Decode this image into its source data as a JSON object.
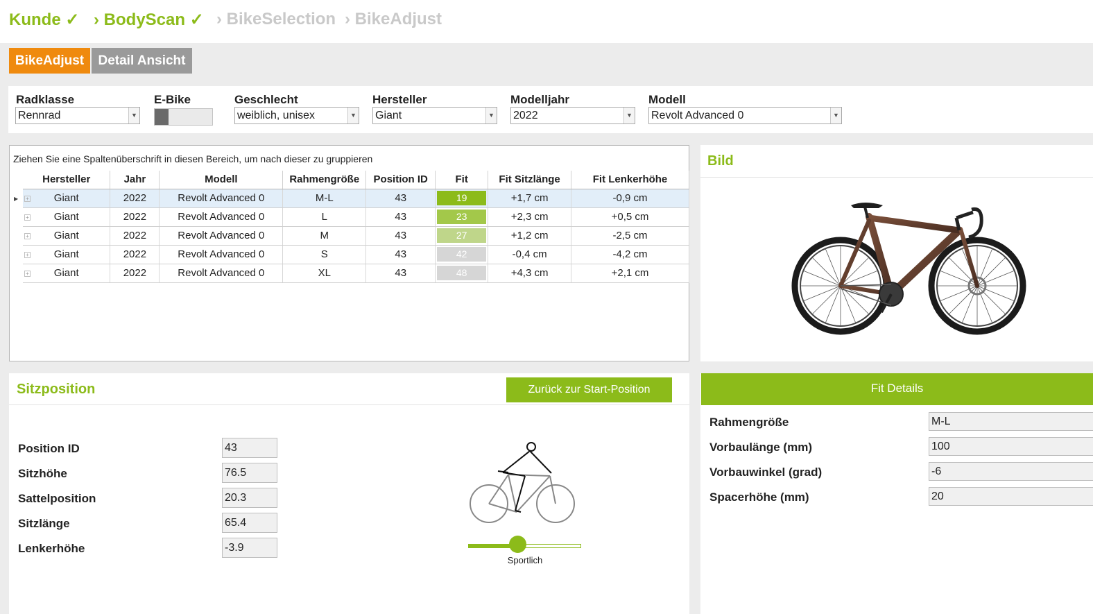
{
  "breadcrumb": {
    "steps": [
      {
        "label": "Kunde ✓",
        "state": "done"
      },
      {
        "label": "› BodyScan ✓",
        "state": "done"
      },
      {
        "label": "› BikeSelection",
        "state": "todo"
      },
      {
        "label": "› BikeAdjust",
        "state": "todo"
      }
    ]
  },
  "tabs": {
    "bikeadjust": "BikeAdjust",
    "detail": "Detail Ansicht"
  },
  "filters": {
    "radklasse": {
      "label": "Radklasse",
      "value": "Rennrad"
    },
    "ebike": {
      "label": "E-Bike",
      "on": false
    },
    "geschlecht": {
      "label": "Geschlecht",
      "value": "weiblich, unisex"
    },
    "hersteller": {
      "label": "Hersteller",
      "value": "Giant"
    },
    "modelljahr": {
      "label": "Modelljahr",
      "value": "2022"
    },
    "modell": {
      "label": "Modell",
      "value": "Revolt Advanced 0"
    }
  },
  "grid": {
    "group_hint": "Ziehen Sie eine Spaltenüberschrift in diesen Bereich, um nach dieser zu gruppieren",
    "columns": [
      "Hersteller",
      "Jahr",
      "Modell",
      "Rahmengröße",
      "Position ID",
      "Fit",
      "Fit Sitzlänge",
      "Fit Lenkerhöhe"
    ],
    "rows": [
      {
        "hersteller": "Giant",
        "jahr": "2022",
        "modell": "Revolt Advanced 0",
        "groesse": "M-L",
        "position": "43",
        "fit": "19",
        "fit_color": "#8cbb1a",
        "sitz": "+1,7 cm",
        "lenker": "-0,9 cm",
        "selected": true
      },
      {
        "hersteller": "Giant",
        "jahr": "2022",
        "modell": "Revolt Advanced 0",
        "groesse": "L",
        "position": "43",
        "fit": "23",
        "fit_color": "#a3c84a",
        "sitz": "+2,3 cm",
        "lenker": "+0,5 cm",
        "selected": false
      },
      {
        "hersteller": "Giant",
        "jahr": "2022",
        "modell": "Revolt Advanced 0",
        "groesse": "M",
        "position": "43",
        "fit": "27",
        "fit_color": "#bfd68a",
        "sitz": "+1,2 cm",
        "lenker": "-2,5 cm",
        "selected": false
      },
      {
        "hersteller": "Giant",
        "jahr": "2022",
        "modell": "Revolt Advanced 0",
        "groesse": "S",
        "position": "43",
        "fit": "42",
        "fit_color": "#d6d6d6",
        "sitz": "-0,4 cm",
        "lenker": "-4,2 cm",
        "selected": false
      },
      {
        "hersteller": "Giant",
        "jahr": "2022",
        "modell": "Revolt Advanced 0",
        "groesse": "XL",
        "position": "43",
        "fit": "48",
        "fit_color": "#d6d6d6",
        "sitz": "+4,3 cm",
        "lenker": "+2,1 cm",
        "selected": false
      }
    ]
  },
  "bild": {
    "title": "Bild"
  },
  "sitzposition": {
    "title": "Sitzposition",
    "reset_button": "Zurück zur Start-Position",
    "fields": [
      {
        "label": "Position ID",
        "value": "43"
      },
      {
        "label": "Sitzhöhe",
        "value": "76.5"
      },
      {
        "label": "Sattelposition",
        "value": "20.3"
      },
      {
        "label": "Sitzlänge",
        "value": "65.4"
      },
      {
        "label": "Lenkerhöhe",
        "value": "-3.9"
      }
    ],
    "slider": {
      "label": "Sportlich",
      "level": 0.44
    }
  },
  "fit_details": {
    "title": "Fit Details",
    "fields": [
      {
        "label": "Rahmengröße",
        "value": "M-L"
      },
      {
        "label": "Vorbaulänge (mm)",
        "value": "100"
      },
      {
        "label": "Vorbauwinkel (grad)",
        "value": "-6"
      },
      {
        "label": "Spacerhöhe (mm)",
        "value": "20"
      }
    ]
  },
  "colors": {
    "accent": "#8cbb1a",
    "active_tab": "#ef8a0e",
    "inactive_tab": "#9a9a9a"
  }
}
